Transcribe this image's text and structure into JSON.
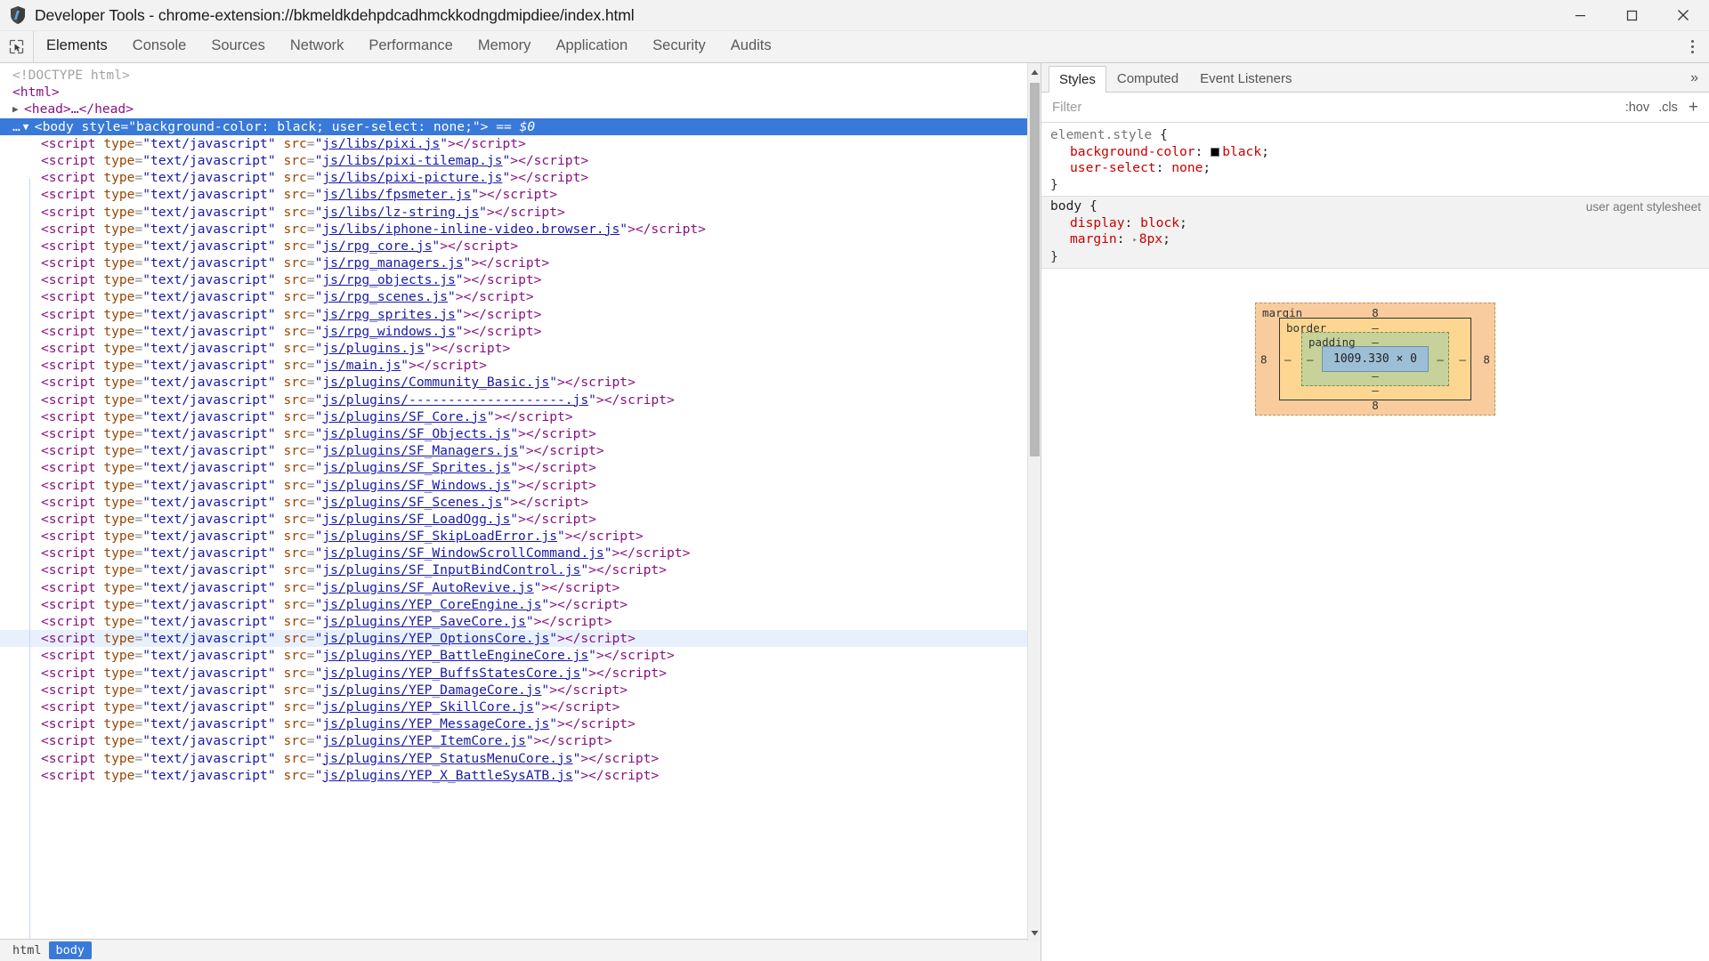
{
  "window": {
    "title": "Developer Tools - chrome-extension://bkmeldkdehpdcadhmckkodngdmipdiee/index.html",
    "app_icon": "devtools-icon",
    "minimize_label": "Minimize",
    "maximize_label": "Maximize",
    "close_label": "Close"
  },
  "toolbar": {
    "inspect_icon": "inspect-element-icon",
    "more_label": "More tools",
    "tabs": [
      {
        "label": "Elements",
        "active": true
      },
      {
        "label": "Console",
        "active": false
      },
      {
        "label": "Sources",
        "active": false
      },
      {
        "label": "Network",
        "active": false
      },
      {
        "label": "Performance",
        "active": false
      },
      {
        "label": "Memory",
        "active": false
      },
      {
        "label": "Application",
        "active": false
      },
      {
        "label": "Security",
        "active": false
      },
      {
        "label": "Audits",
        "active": false
      }
    ]
  },
  "dom": {
    "doctype": "<!DOCTYPE html>",
    "html_open": "<html>",
    "head_collapsed": "<head>…</head>",
    "body": {
      "tag_open": "<body",
      "attr_name": "style",
      "attr_value": "background-color: black; user-select: none;",
      "tag_close": ">",
      "selected_marker": "== $0",
      "ellipsis": "…"
    },
    "script_attr_type_name": "type",
    "script_attr_type_value": "text/javascript",
    "script_attr_src_name": "src",
    "scripts": [
      "js/libs/pixi.js",
      "js/libs/pixi-tilemap.js",
      "js/libs/pixi-picture.js",
      "js/libs/fpsmeter.js",
      "js/libs/lz-string.js",
      "js/libs/iphone-inline-video.browser.js",
      "js/rpg_core.js",
      "js/rpg_managers.js",
      "js/rpg_objects.js",
      "js/rpg_scenes.js",
      "js/rpg_sprites.js",
      "js/rpg_windows.js",
      "js/plugins.js",
      "js/main.js",
      "js/plugins/Community_Basic.js",
      "js/plugins/--------------------.js",
      "js/plugins/SF_Core.js",
      "js/plugins/SF_Objects.js",
      "js/plugins/SF_Managers.js",
      "js/plugins/SF_Sprites.js",
      "js/plugins/SF_Windows.js",
      "js/plugins/SF_Scenes.js",
      "js/plugins/SF_LoadOgg.js",
      "js/plugins/SF_SkipLoadError.js",
      "js/plugins/SF_WindowScrollCommand.js",
      "js/plugins/SF_InputBindControl.js",
      "js/plugins/SF_AutoRevive.js",
      "js/plugins/YEP_CoreEngine.js",
      "js/plugins/YEP_SaveCore.js",
      "js/plugins/YEP_OptionsCore.js",
      "js/plugins/YEP_BattleEngineCore.js",
      "js/plugins/YEP_BuffsStatesCore.js",
      "js/plugins/YEP_DamageCore.js",
      "js/plugins/YEP_SkillCore.js",
      "js/plugins/YEP_MessageCore.js",
      "js/plugins/YEP_ItemCore.js",
      "js/plugins/YEP_StatusMenuCore.js",
      "js/plugins/YEP_X_BattleSysATB.js"
    ],
    "selected_script_index": 29,
    "breadcrumb": [
      {
        "label": "html",
        "active": false
      },
      {
        "label": "body",
        "active": true
      }
    ]
  },
  "styles": {
    "tabs": [
      {
        "label": "Styles",
        "active": true
      },
      {
        "label": "Computed",
        "active": false
      },
      {
        "label": "Event Listeners",
        "active": false
      }
    ],
    "more_icon": "chevron-double-right-icon",
    "filter_placeholder": "Filter",
    "filter_value": "",
    "hov_label": ":hov",
    "cls_label": ".cls",
    "new_rule_label": "+",
    "rules": [
      {
        "selector": "element.style",
        "open_brace": "{",
        "close_brace": "}",
        "source": "",
        "declarations": [
          {
            "prop": "background-color",
            "value": "black",
            "swatch": "#000000",
            "has_swatch": true,
            "has_tri": false
          },
          {
            "prop": "user-select",
            "value": "none",
            "has_swatch": false,
            "has_tri": false
          }
        ]
      },
      {
        "selector": "body",
        "open_brace": "{",
        "close_brace": "}",
        "source": "user agent stylesheet",
        "declarations": [
          {
            "prop": "display",
            "value": "block",
            "has_swatch": false,
            "has_tri": false
          },
          {
            "prop": "margin",
            "value": "8px",
            "has_swatch": false,
            "has_tri": true
          }
        ]
      }
    ],
    "box_model": {
      "margin_label": "margin",
      "border_label": "border",
      "padding_label": "padding",
      "content_size": "1009.330 × 0",
      "margin_top": "8",
      "margin_right": "8",
      "margin_bottom": "8",
      "margin_left": "8",
      "border_top": "–",
      "border_right": "–",
      "border_bottom": "–",
      "border_left": "–",
      "padding_top": "–",
      "padding_right": "–",
      "padding_bottom": "–",
      "padding_left": "–"
    }
  },
  "colors": {
    "selection_blue": "#3879d9",
    "hover_blue": "#e8f0fe",
    "tag_purple": "#881280",
    "attr_orange": "#994500",
    "value_blue": "#1a1aa6",
    "prop_red": "#c80000",
    "box_margin": "#f9cc9d",
    "box_border": "#fdd791",
    "box_padding": "#c6d29a",
    "box_content": "#9dbfd6"
  }
}
